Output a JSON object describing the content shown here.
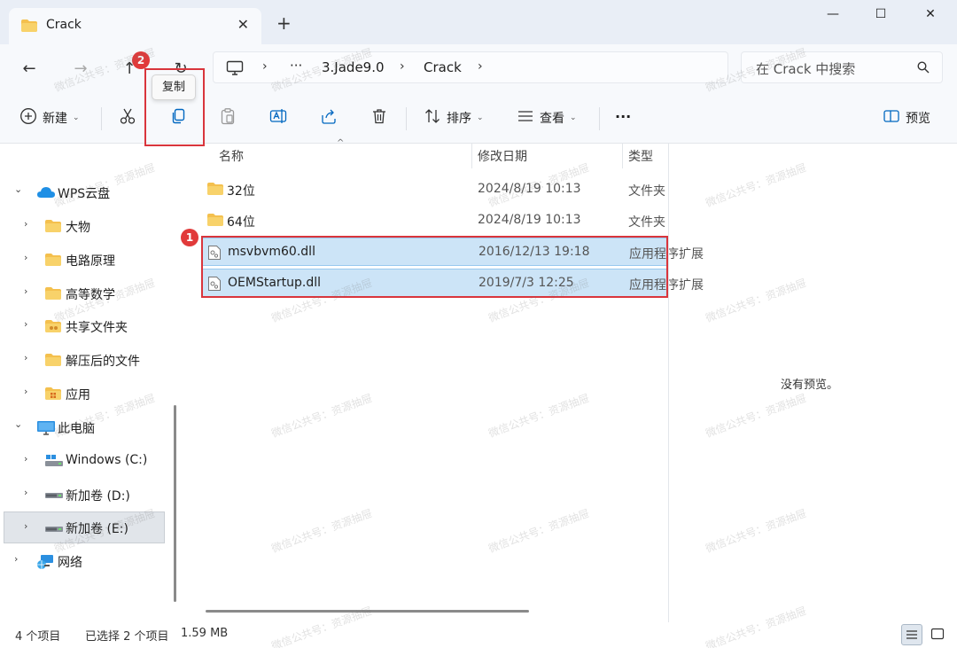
{
  "tab": {
    "title": "Crack",
    "close": "✕",
    "new_tab": "+"
  },
  "window": {
    "minimize": "—",
    "maximize": "☐",
    "close": "✕"
  },
  "nav": {
    "back": "←",
    "forward": "→",
    "up": "↑",
    "refresh": "↻"
  },
  "breadcrumb": {
    "ellipsis": "···",
    "items": [
      "3.Jade9.0",
      "Crack"
    ]
  },
  "search": {
    "placeholder": "在 Crack 中搜索"
  },
  "toolbar": {
    "new_label": "新建",
    "copy_tooltip": "复制",
    "sort_label": "排序",
    "view_label": "查看",
    "more": "···",
    "preview_label": "预览"
  },
  "annotations": {
    "step1": "1",
    "step2": "2",
    "highlight_color": "#d9353c"
  },
  "sidebar": {
    "items": [
      {
        "label": "WPS云盘"
      },
      {
        "label": "大物"
      },
      {
        "label": "电路原理"
      },
      {
        "label": "高等数学"
      },
      {
        "label": "共享文件夹"
      },
      {
        "label": "解压后的文件"
      },
      {
        "label": "应用"
      },
      {
        "label": "此电脑"
      },
      {
        "label": "Windows (C:)"
      },
      {
        "label": "新加卷 (D:)"
      },
      {
        "label": "新加卷 (E:)"
      },
      {
        "label": "网络"
      }
    ]
  },
  "columns": {
    "name": "名称",
    "date": "修改日期",
    "type": "类型"
  },
  "files": [
    {
      "name": "32位",
      "date": "2024/8/19 10:13",
      "type": "文件夹",
      "kind": "folder-icon",
      "selected": false
    },
    {
      "name": "64位",
      "date": "2024/8/19 10:13",
      "type": "文件夹",
      "kind": "folder-icon",
      "selected": false
    },
    {
      "name": "msvbvm60.dll",
      "date": "2016/12/13 19:18",
      "type": "应用程序扩展",
      "kind": "dll-file-icon",
      "selected": true
    },
    {
      "name": "OEMStartup.dll",
      "date": "2019/7/3 12:25",
      "type": "应用程序扩展",
      "kind": "dll-file-icon",
      "selected": true
    }
  ],
  "preview": {
    "empty_text": "没有预览。"
  },
  "status": {
    "item_count": "4 个项目",
    "selection": "已选择 2 个项目",
    "size": "1.59 MB"
  },
  "watermark": "微信公共号：资源抽屉",
  "colors": {
    "accent": "#0067c0",
    "selection_bg": "#cce4f7",
    "folder": "#f4c04e"
  }
}
